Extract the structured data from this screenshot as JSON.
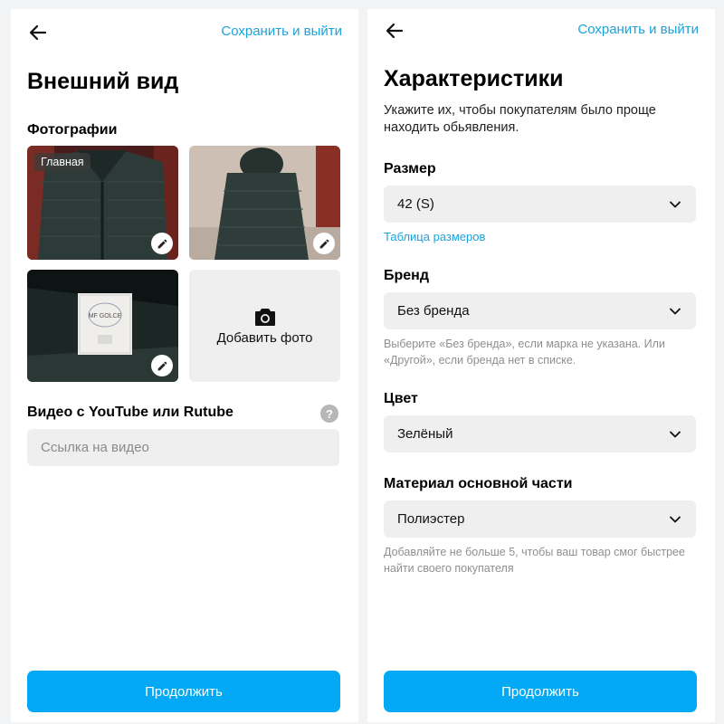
{
  "colors": {
    "accent": "#1aa3dc",
    "button": "#03a9f4",
    "field_bg": "#efefef"
  },
  "left": {
    "save_exit": "Сохранить и выйти",
    "title": "Внешний вид",
    "photos_label": "Фотографии",
    "main_badge": "Главная",
    "label_text": "MF GOLCE",
    "add_photo": "Добавить фото",
    "video_label": "Видео с YouTube или Rutube",
    "help_glyph": "?",
    "video_placeholder": "Ссылка на видео",
    "continue": "Продолжить"
  },
  "right": {
    "save_exit": "Сохранить и выйти",
    "title": "Характеристики",
    "subtitle": "Укажите их, чтобы покупателям было проще находить обьявления.",
    "size_label": "Размер",
    "size_value": "42 (S)",
    "size_table_link": "Таблица размеров",
    "brand_label": "Бренд",
    "brand_value": "Без бренда",
    "brand_hint": "Выберите «Без бренда», если марка не указана. Или «Другой», если бренда нет в списке.",
    "color_label": "Цвет",
    "color_value": "Зелёный",
    "material_label": "Материал основной части",
    "material_value": "Полиэстер",
    "material_hint": "Добавляйте не больше 5, чтобы ваш товар смог быстрее найти своего покупателя",
    "continue": "Продолжить"
  }
}
